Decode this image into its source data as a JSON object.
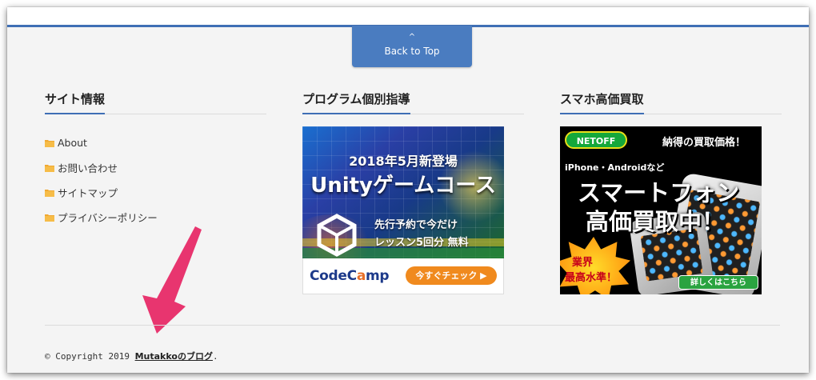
{
  "back_to_top": {
    "caret": "^",
    "label": "Back to Top"
  },
  "site_info": {
    "title": "サイト情報",
    "links": [
      "About",
      "お問い合わせ",
      "サイトマップ",
      "プライバシーポリシー"
    ]
  },
  "program": {
    "title": "プログラム個別指導",
    "banner": {
      "line1": "2018年5月新登場",
      "line2": "Unityゲームコース",
      "line3": "先行予約で今だけ",
      "line4": "レッスン5回分 無料",
      "logo_text_1": "CodeC",
      "logo_text_accent": "a",
      "logo_text_2": "mp",
      "cta": "今すぐチェック ▶"
    }
  },
  "smartphone": {
    "title": "スマホ高価買取",
    "banner": {
      "logo": "NETOFF",
      "headline": "納得の買取価格！",
      "sub": "iPhone・Androidなど",
      "big1": "スマートフォン",
      "big2": "高価買取中！",
      "burst1": "業界",
      "burst2": "最高水準！",
      "cta": "詳しくはこちら"
    }
  },
  "footer": {
    "copyright_prefix": "© Copyright 2019 ",
    "blog_link": "Mutakkoのブログ",
    "suffix": "."
  },
  "colors": {
    "accent_blue": "#3f6fb5",
    "annotation_arrow": "#e8356f",
    "folder": "#f0a830"
  }
}
